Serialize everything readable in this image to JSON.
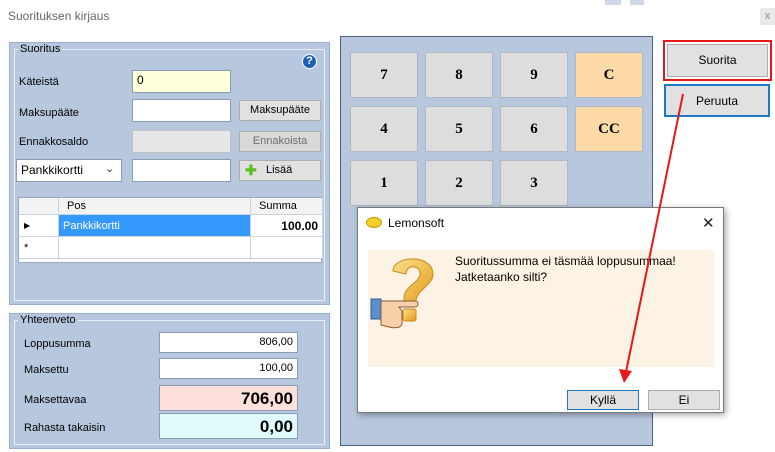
{
  "window": {
    "title": "Suorituksen kirjaus",
    "close_glyph": "x"
  },
  "suoritus": {
    "group_label": "Suoritus",
    "help_icon": "?",
    "cash_label": "Käteistä",
    "cash_value": "0",
    "payment_method_label": "Maksupääte",
    "payment_method_value": "",
    "payment_method_button": "Maksupääte",
    "advance_label": "Ennakkosaldo",
    "advance_value": "",
    "advance_button": "Ennakoista",
    "card_select_value": "Pankkikortti",
    "card_amount_value": "",
    "add_button": "Lisää"
  },
  "grid": {
    "columns": [
      "Pos",
      "Summa"
    ],
    "rows": [
      {
        "marker": "▶",
        "pos": "Pankkikortti",
        "summa": "100.00"
      }
    ],
    "new_row_marker": "*"
  },
  "summary": {
    "group_label": "Yhteenveto",
    "total_label": "Loppusumma",
    "total_value": "806,00",
    "paid_label": "Maksettu",
    "paid_value": "100,00",
    "due_label": "Maksettavaa",
    "due_value": "706,00",
    "change_label": "Rahasta takaisin",
    "change_value": "0,00"
  },
  "keypad": {
    "keys": [
      "7",
      "8",
      "9",
      "C",
      "4",
      "5",
      "6",
      "CC",
      "1",
      "2",
      "3"
    ]
  },
  "actions": {
    "submit_label": "Suorita",
    "cancel_label": "Peruuta"
  },
  "dialog": {
    "title": "Lemonsoft",
    "close_glyph": "✕",
    "message_line1": "Suoritussumma ei täsmää loppusummaa!",
    "message_line2": "Jatketaanko silti?",
    "yes_label": "Kyllä",
    "no_label": "Ei"
  },
  "colors": {
    "panel_bg": "#b7c7de",
    "keypad_orange": "#fdd9a8",
    "highlight_red": "#e81818",
    "highlight_blue": "#1c79c8",
    "selected_row": "#3399ff",
    "due_bg": "#fde0dc",
    "change_bg": "#e0fbfb",
    "dialog_message_bg": "#fdf3e4"
  }
}
